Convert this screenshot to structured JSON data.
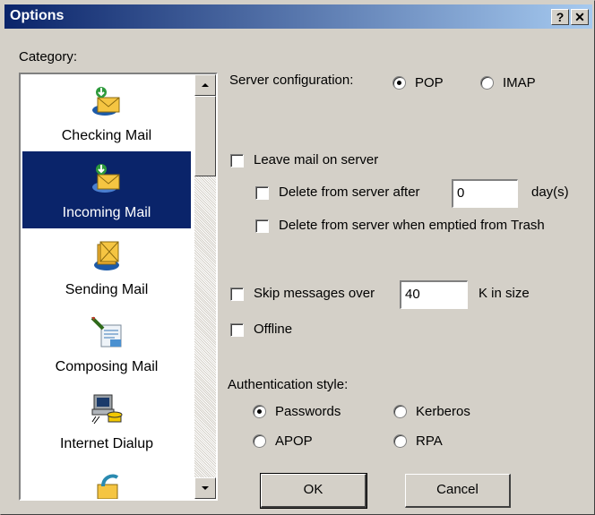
{
  "window": {
    "title": "Options",
    "help_btn": "?",
    "close_btn": "✕"
  },
  "category": {
    "label": "Category:",
    "items": [
      {
        "label": "Checking Mail",
        "icon": "checking-mail-icon",
        "selected": false
      },
      {
        "label": "Incoming Mail",
        "icon": "incoming-mail-icon",
        "selected": true
      },
      {
        "label": "Sending Mail",
        "icon": "sending-mail-icon",
        "selected": false
      },
      {
        "label": "Composing Mail",
        "icon": "composing-mail-icon",
        "selected": false
      },
      {
        "label": "Internet Dialup",
        "icon": "internet-dialup-icon",
        "selected": false
      }
    ]
  },
  "server": {
    "label": "Server configuration:",
    "pop": "POP",
    "imap": "IMAP",
    "selected": "POP"
  },
  "leave_mail": {
    "label": "Leave mail on server",
    "delete_after_label": "Delete from server after",
    "delete_after_value": "0",
    "days_label": "day(s)",
    "delete_trash_label": "Delete from server when emptied from Trash"
  },
  "skip": {
    "label": "Skip messages over",
    "value": "40",
    "unit": "K in size"
  },
  "offline": {
    "label": "Offline"
  },
  "auth": {
    "label": "Authentication style:",
    "passwords": "Passwords",
    "kerberos": "Kerberos",
    "apop": "APOP",
    "rpa": "RPA",
    "selected": "Passwords"
  },
  "buttons": {
    "ok": "OK",
    "cancel": "Cancel"
  }
}
